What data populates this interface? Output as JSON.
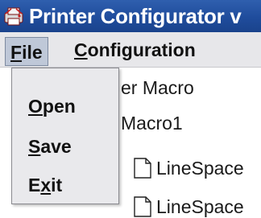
{
  "window": {
    "title": "Printer Configurator v"
  },
  "menubar": {
    "file": "File",
    "configuration": "Configuration"
  },
  "file_menu": {
    "items": [
      "Open",
      "Save",
      "Exit"
    ]
  },
  "tree": {
    "items": [
      "er Macro",
      "Macro1",
      "LineSpace",
      "LineSpace"
    ]
  },
  "colors": {
    "titlebar": "#1f4c9c",
    "menubar": "#e7e7ea",
    "menu_highlight": "#bfc8d8"
  },
  "icons": {
    "app": "printer-app-icon",
    "tree_item": "document-icon"
  }
}
